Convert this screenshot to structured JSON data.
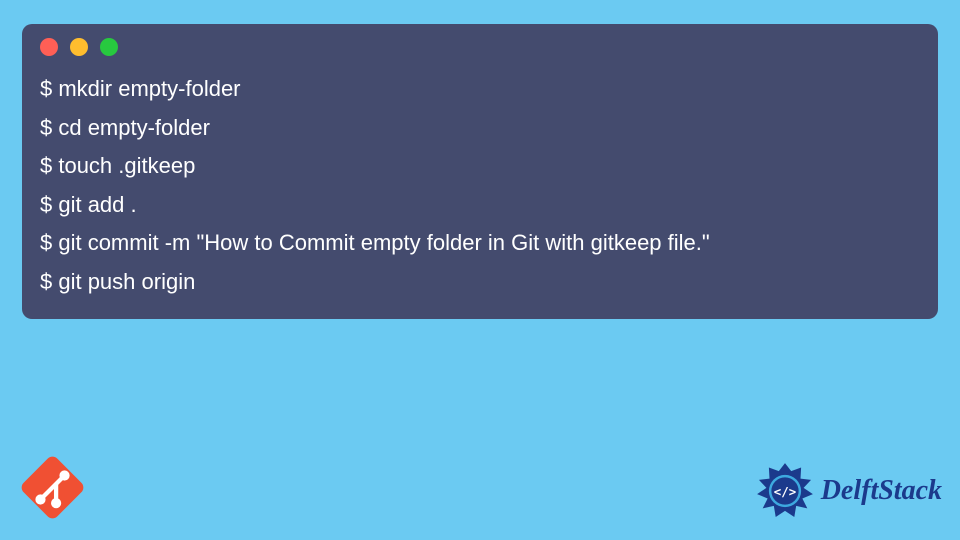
{
  "terminal": {
    "lines": [
      "$ mkdir empty-folder",
      "$ cd empty-folder",
      "$ touch .gitkeep",
      "$ git add .",
      "$ git commit -m \"How to Commit empty folder in Git with gitkeep file.\"",
      "$ git push origin"
    ]
  },
  "branding": {
    "delftstack": "DelftStack"
  }
}
